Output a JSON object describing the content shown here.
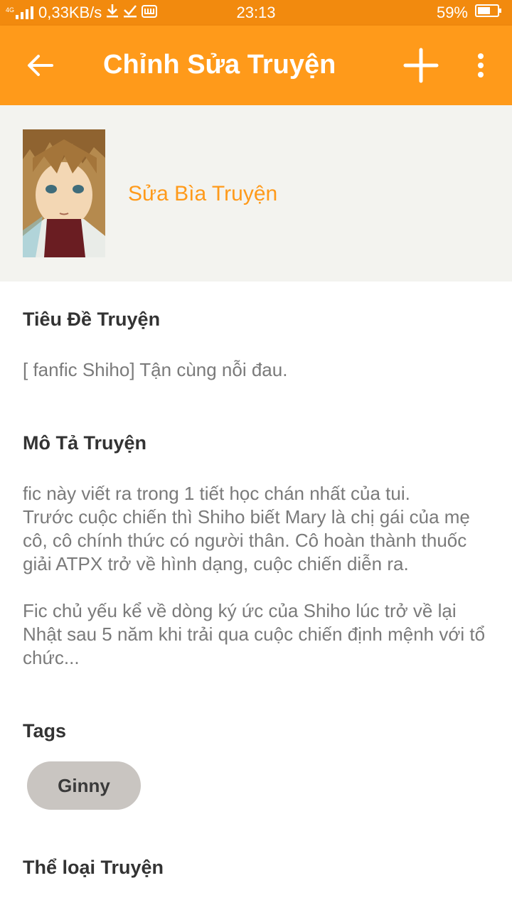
{
  "status_bar": {
    "network": "4G",
    "speed": "0,33KB/s",
    "time": "23:13",
    "battery": "59%"
  },
  "app_bar": {
    "title": "Chỉnh Sửa Truyện",
    "back_icon": "arrow-left-icon",
    "add_icon": "plus-icon",
    "more_icon": "more-vertical-icon"
  },
  "cover": {
    "edit_label": "Sửa Bìa Truyện"
  },
  "story": {
    "title_label": "Tiêu Đề Truyện",
    "title_value": "[ fanfic Shiho] Tận cùng nỗi đau.",
    "description_label": "Mô Tả Truyện",
    "description_value": "fic này viết ra trong 1 tiết học chán nhất của tui.\nTrước cuộc chiến thì Shiho biết Mary là chị gái của mẹ cô, cô chính thức có người thân. Cô hoàn thành thuốc giải ATPX trở về hình dạng, cuộc chiến diễn ra.\n\nFic chủ yếu kể về dòng ký ức của Shiho lúc trở về lại Nhật sau 5 năm  khi trải qua cuộc chiến định mệnh với tổ chức...",
    "tags_label": "Tags",
    "tags": [
      "Ginny"
    ],
    "genre_label": "Thể loại Truyện"
  },
  "colors": {
    "status_bar": "#f28a0e",
    "app_bar": "#ff9a1a",
    "accent": "#ff9a1a"
  }
}
